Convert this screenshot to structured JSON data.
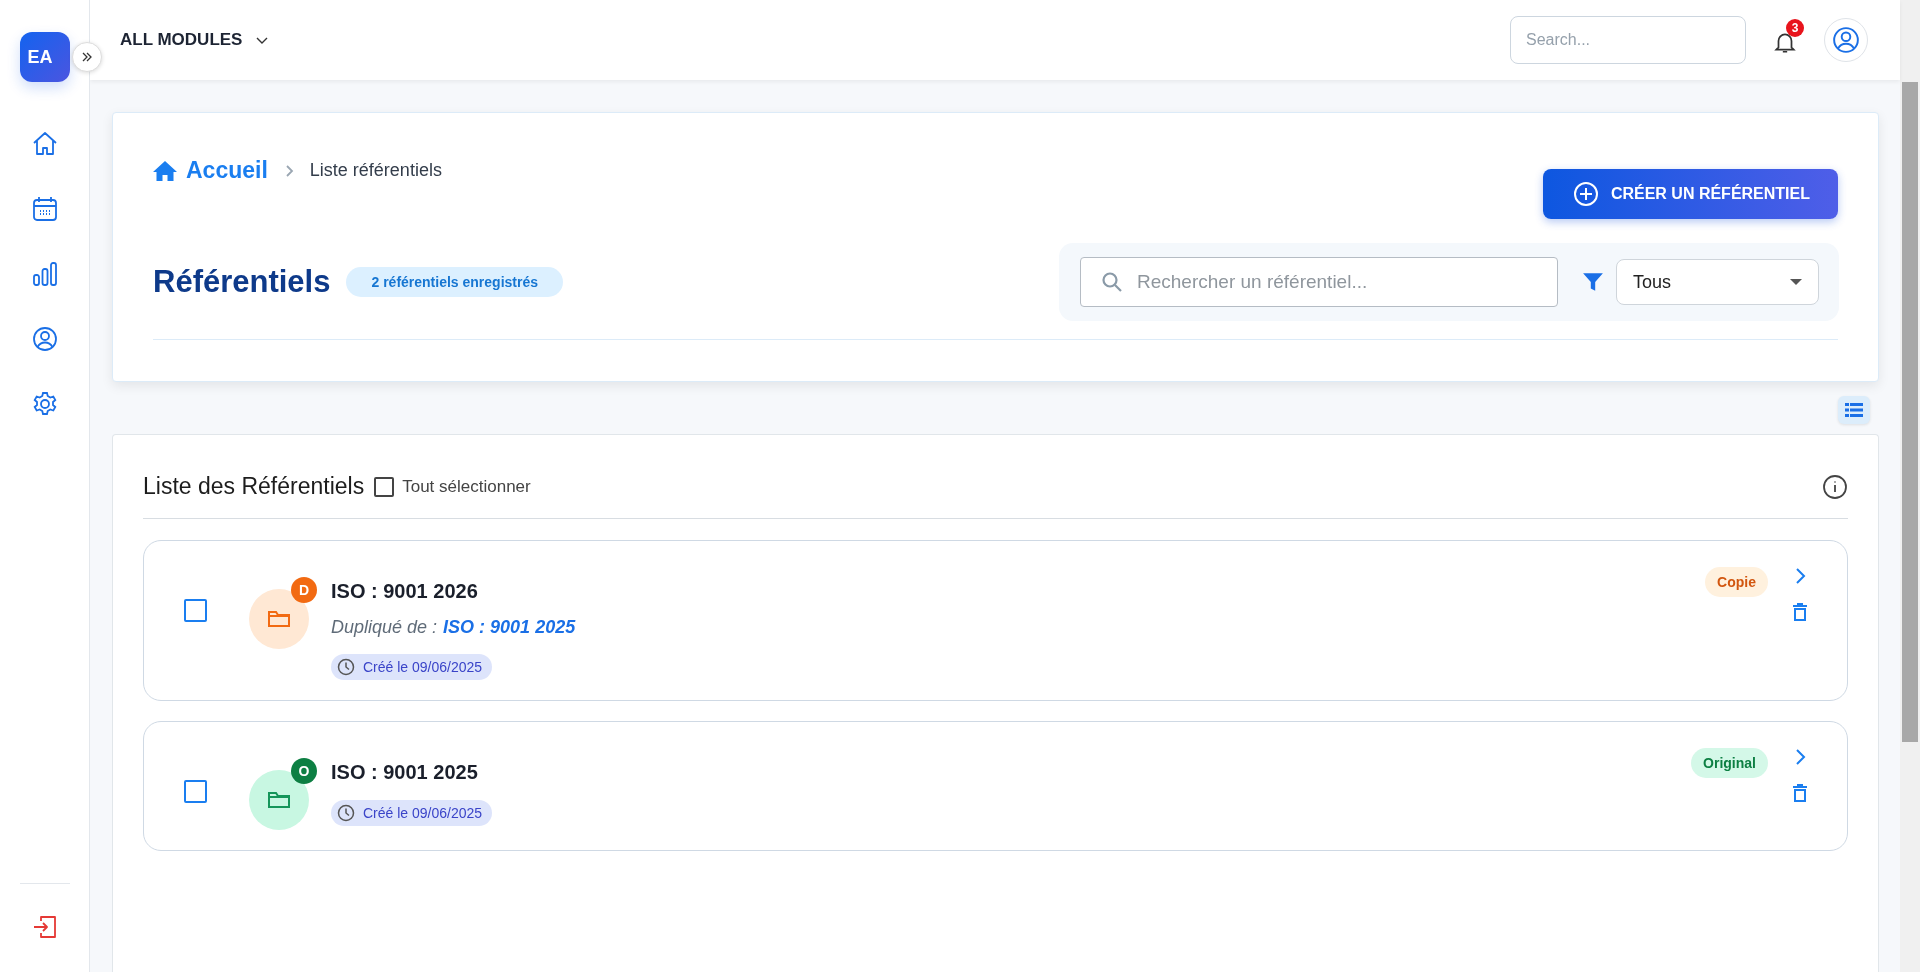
{
  "sidebar": {
    "logo": "EA"
  },
  "header": {
    "module_selector": "ALL MODULES",
    "search": {
      "placeholder": "Search..."
    },
    "notifications": "3"
  },
  "breadcrumb": {
    "home": "Accueil",
    "current": "Liste référentiels"
  },
  "create_button": "CRÉER UN RÉFÉRENTIEL",
  "page_title": "Référentiels",
  "count_badge": "2 référentiels enregistrés",
  "filter": {
    "search_placeholder": "Rechercher un référentiel...",
    "select_value": "Tous"
  },
  "list": {
    "title": "Liste des Référentiels",
    "select_all": {
      "label": "Tout sélectionner",
      "checked": false
    },
    "items": [
      {
        "kind": "copy",
        "letter": "D",
        "title": "ISO : 9001 2026",
        "duplicated_label": "Dupliqué de :",
        "duplicated_from": "ISO : 9001 2025",
        "created": "Créé le 09/06/2025",
        "tag": "Copie",
        "checked": false
      },
      {
        "kind": "original",
        "letter": "O",
        "title": "ISO : 9001 2025",
        "created": "Créé le 09/06/2025",
        "tag": "Original",
        "checked": false
      }
    ]
  }
}
